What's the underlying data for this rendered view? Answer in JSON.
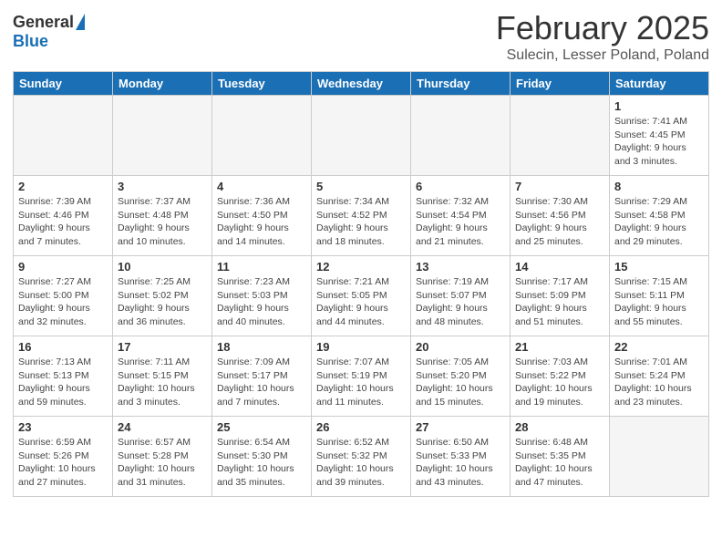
{
  "header": {
    "logo": {
      "general": "General",
      "blue": "Blue"
    },
    "title": "February 2025",
    "location": "Sulecin, Lesser Poland, Poland"
  },
  "weekdays": [
    "Sunday",
    "Monday",
    "Tuesday",
    "Wednesday",
    "Thursday",
    "Friday",
    "Saturday"
  ],
  "weeks": [
    [
      {
        "day": "",
        "info": ""
      },
      {
        "day": "",
        "info": ""
      },
      {
        "day": "",
        "info": ""
      },
      {
        "day": "",
        "info": ""
      },
      {
        "day": "",
        "info": ""
      },
      {
        "day": "",
        "info": ""
      },
      {
        "day": "1",
        "info": "Sunrise: 7:41 AM\nSunset: 4:45 PM\nDaylight: 9 hours and 3 minutes."
      }
    ],
    [
      {
        "day": "2",
        "info": "Sunrise: 7:39 AM\nSunset: 4:46 PM\nDaylight: 9 hours and 7 minutes."
      },
      {
        "day": "3",
        "info": "Sunrise: 7:37 AM\nSunset: 4:48 PM\nDaylight: 9 hours and 10 minutes."
      },
      {
        "day": "4",
        "info": "Sunrise: 7:36 AM\nSunset: 4:50 PM\nDaylight: 9 hours and 14 minutes."
      },
      {
        "day": "5",
        "info": "Sunrise: 7:34 AM\nSunset: 4:52 PM\nDaylight: 9 hours and 18 minutes."
      },
      {
        "day": "6",
        "info": "Sunrise: 7:32 AM\nSunset: 4:54 PM\nDaylight: 9 hours and 21 minutes."
      },
      {
        "day": "7",
        "info": "Sunrise: 7:30 AM\nSunset: 4:56 PM\nDaylight: 9 hours and 25 minutes."
      },
      {
        "day": "8",
        "info": "Sunrise: 7:29 AM\nSunset: 4:58 PM\nDaylight: 9 hours and 29 minutes."
      }
    ],
    [
      {
        "day": "9",
        "info": "Sunrise: 7:27 AM\nSunset: 5:00 PM\nDaylight: 9 hours and 32 minutes."
      },
      {
        "day": "10",
        "info": "Sunrise: 7:25 AM\nSunset: 5:02 PM\nDaylight: 9 hours and 36 minutes."
      },
      {
        "day": "11",
        "info": "Sunrise: 7:23 AM\nSunset: 5:03 PM\nDaylight: 9 hours and 40 minutes."
      },
      {
        "day": "12",
        "info": "Sunrise: 7:21 AM\nSunset: 5:05 PM\nDaylight: 9 hours and 44 minutes."
      },
      {
        "day": "13",
        "info": "Sunrise: 7:19 AM\nSunset: 5:07 PM\nDaylight: 9 hours and 48 minutes."
      },
      {
        "day": "14",
        "info": "Sunrise: 7:17 AM\nSunset: 5:09 PM\nDaylight: 9 hours and 51 minutes."
      },
      {
        "day": "15",
        "info": "Sunrise: 7:15 AM\nSunset: 5:11 PM\nDaylight: 9 hours and 55 minutes."
      }
    ],
    [
      {
        "day": "16",
        "info": "Sunrise: 7:13 AM\nSunset: 5:13 PM\nDaylight: 9 hours and 59 minutes."
      },
      {
        "day": "17",
        "info": "Sunrise: 7:11 AM\nSunset: 5:15 PM\nDaylight: 10 hours and 3 minutes."
      },
      {
        "day": "18",
        "info": "Sunrise: 7:09 AM\nSunset: 5:17 PM\nDaylight: 10 hours and 7 minutes."
      },
      {
        "day": "19",
        "info": "Sunrise: 7:07 AM\nSunset: 5:19 PM\nDaylight: 10 hours and 11 minutes."
      },
      {
        "day": "20",
        "info": "Sunrise: 7:05 AM\nSunset: 5:20 PM\nDaylight: 10 hours and 15 minutes."
      },
      {
        "day": "21",
        "info": "Sunrise: 7:03 AM\nSunset: 5:22 PM\nDaylight: 10 hours and 19 minutes."
      },
      {
        "day": "22",
        "info": "Sunrise: 7:01 AM\nSunset: 5:24 PM\nDaylight: 10 hours and 23 minutes."
      }
    ],
    [
      {
        "day": "23",
        "info": "Sunrise: 6:59 AM\nSunset: 5:26 PM\nDaylight: 10 hours and 27 minutes."
      },
      {
        "day": "24",
        "info": "Sunrise: 6:57 AM\nSunset: 5:28 PM\nDaylight: 10 hours and 31 minutes."
      },
      {
        "day": "25",
        "info": "Sunrise: 6:54 AM\nSunset: 5:30 PM\nDaylight: 10 hours and 35 minutes."
      },
      {
        "day": "26",
        "info": "Sunrise: 6:52 AM\nSunset: 5:32 PM\nDaylight: 10 hours and 39 minutes."
      },
      {
        "day": "27",
        "info": "Sunrise: 6:50 AM\nSunset: 5:33 PM\nDaylight: 10 hours and 43 minutes."
      },
      {
        "day": "28",
        "info": "Sunrise: 6:48 AM\nSunset: 5:35 PM\nDaylight: 10 hours and 47 minutes."
      },
      {
        "day": "",
        "info": ""
      }
    ]
  ]
}
